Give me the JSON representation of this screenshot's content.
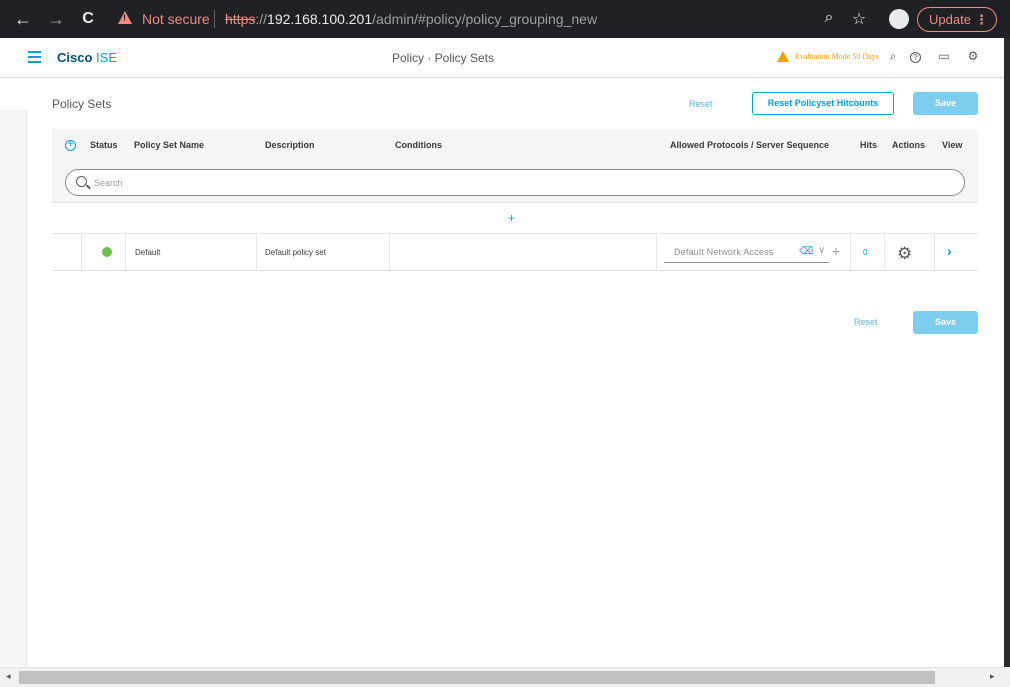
{
  "browser": {
    "security_label": "Not secure",
    "url_scheme": "https",
    "url_sep": "://",
    "url_host": "192.168.100.201",
    "url_path": "/admin/#policy/policy_grouping_new",
    "update_label": "Update",
    "update_menu": "⋮",
    "back_icon": "←",
    "forward_icon": "→",
    "reload_icon": "C",
    "zoom_icon": "⌕",
    "star_icon": "☆"
  },
  "header": {
    "brand_bold": "Cisco",
    "brand_light": "ISE",
    "title": "Policy · Policy Sets",
    "eval_text": "Evaluation Mode 50 Days",
    "search_icon": "⌕",
    "help_icon": "?",
    "monitor_icon": "▭",
    "settings_icon": "⚙"
  },
  "page": {
    "heading": "Policy Sets",
    "reset_label": "Reset",
    "reset_hitcounts_label": "Reset Policyset Hitcounts",
    "save_label": "Save",
    "bottom_reset_label": "Reset",
    "bottom_save_label": "Save"
  },
  "table": {
    "add_icon": "+",
    "columns": {
      "status": "Status",
      "name": "Policy Set Name",
      "description": "Description",
      "conditions": "Conditions",
      "protocols": "Allowed Protocols / Server Sequence",
      "hits": "Hits",
      "actions": "Actions",
      "view": "View"
    },
    "search_placeholder": "Search",
    "add_row_icon": "+",
    "rows": [
      {
        "name": "Default",
        "description": "Default policy set",
        "conditions": "",
        "protocol": "Default Network Access",
        "clear_icon": "⌫",
        "chevron_icon": "∨",
        "plus_icon": "+",
        "hits": "0",
        "gear_icon": "⚙",
        "view_icon": "›"
      }
    ]
  },
  "colors": {
    "accent": "#049fd9",
    "status_ok": "#6cc04a",
    "warning": "#f2a000",
    "save_disabled": "#7ccdee"
  }
}
